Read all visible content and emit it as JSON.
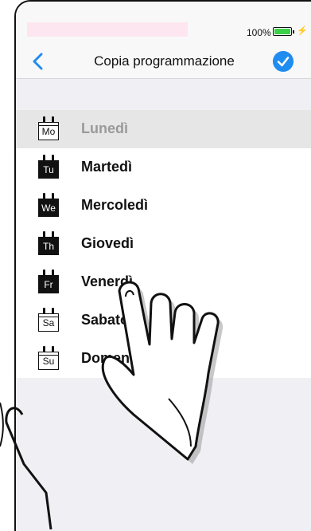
{
  "status_bar": {
    "battery_percent": "100%",
    "battery_fill": 1.0,
    "charging": true
  },
  "nav": {
    "back_icon": "chevron-left-icon",
    "title": "Copia programmazione",
    "done_icon": "checkmark-circle-icon"
  },
  "days": [
    {
      "abbr": "Mo",
      "label": "Lunedì",
      "selected": true,
      "icon_style": "outline"
    },
    {
      "abbr": "Tu",
      "label": "Martedì",
      "selected": false,
      "icon_style": "filled"
    },
    {
      "abbr": "We",
      "label": "Mercoledì",
      "selected": false,
      "icon_style": "filled"
    },
    {
      "abbr": "Th",
      "label": "Giovedì",
      "selected": false,
      "icon_style": "filled"
    },
    {
      "abbr": "Fr",
      "label": "Venerdì",
      "selected": false,
      "icon_style": "filled"
    },
    {
      "abbr": "Sa",
      "label": "Sabato",
      "selected": false,
      "icon_style": "outline"
    },
    {
      "abbr": "Su",
      "label": "Domenica",
      "selected": false,
      "icon_style": "outline"
    }
  ],
  "colors": {
    "accent": "#1f8cf0",
    "background": "#efeff4",
    "selected_row": "#e6e6e6",
    "battery": "#3dd04a"
  },
  "overlay": {
    "icon": "pointing-hand-icon"
  }
}
